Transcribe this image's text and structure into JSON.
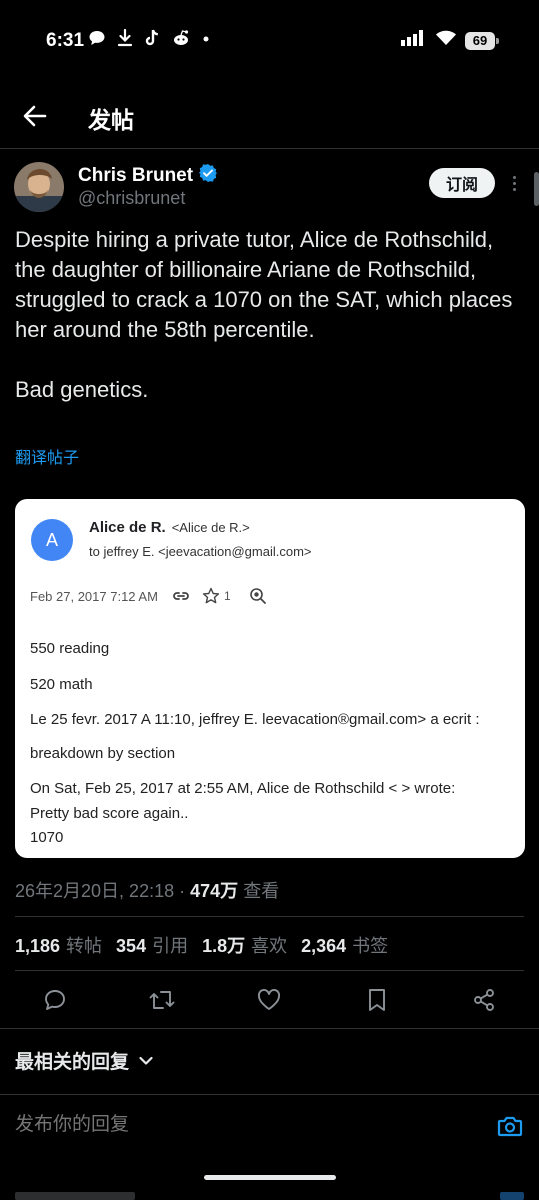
{
  "status_bar": {
    "time": "6:31",
    "battery": "69",
    "left_icons": [
      "chat-bubble-icon",
      "download-icon",
      "tiktok-icon",
      "reddit-icon",
      "dot-icon"
    ],
    "right_icons": [
      "signal-icon",
      "wifi-icon",
      "battery-icon"
    ]
  },
  "header": {
    "title": "发帖",
    "back_icon": "arrow-left-icon"
  },
  "author": {
    "name": "Chris Brunet",
    "handle": "@chrisbrunet",
    "verified": true,
    "subscribe_label": "订阅"
  },
  "post": {
    "paragraphs": [
      "Despite hiring a private tutor, Alice de Rothschild, the daughter of billionaire Ariane de Rothschild, struggled to crack a 1070 on the SAT, which places her around the 58th percentile.",
      "Bad genetics."
    ],
    "translate_label": "翻译帖子"
  },
  "email": {
    "avatar_letter": "A",
    "sender_name": "Alice de R.",
    "sender_addr": "<Alice de R.>",
    "to": "to jeffrey E. <jeevacation@gmail.com>",
    "date": "Feb 27, 2017 7:12 AM",
    "star_count": "1",
    "lines": [
      "550 reading",
      "520 math",
      "Le 25 fevr. 2017 A 11:10, jeffrey E. leevacation®gmail.com> a ecrit :",
      "breakdown by section",
      "On Sat, Feb 25, 2017 at 2:55 AM, Alice de Rothschild < > wrote:",
      "Pretty bad score again..",
      "1070"
    ]
  },
  "meta": {
    "datetime": "26年2月20日, 22:18",
    "separator": "·",
    "views": "474万",
    "views_label": "查看"
  },
  "stats": [
    {
      "value": "1,186",
      "label": "转帖"
    },
    {
      "value": "354",
      "label": "引用"
    },
    {
      "value": "1.8万",
      "label": "喜欢"
    },
    {
      "value": "2,364",
      "label": "书签"
    }
  ],
  "actions": [
    "reply-icon",
    "retweet-icon",
    "like-icon",
    "bookmark-icon",
    "share-icon"
  ],
  "replies": {
    "sort_label": "最相关的回复"
  },
  "reply_box": {
    "placeholder": "发布你的回复"
  },
  "colors": {
    "background": "#000000",
    "text": "#e7e9ea",
    "muted": "#71767b",
    "accent": "#1d9bf0",
    "divider": "#2f3336",
    "email_avatar": "#4285f4"
  }
}
